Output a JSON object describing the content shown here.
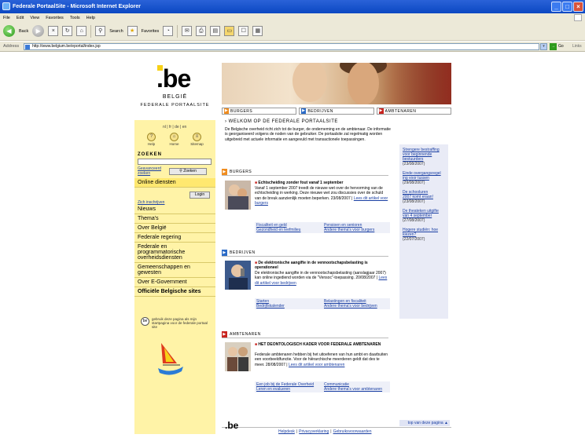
{
  "window": {
    "title": "Federale PortaalSite - Microsoft Internet Explorer",
    "btn_min": "_",
    "btn_max": "□",
    "btn_close": "×"
  },
  "menu": [
    "File",
    "Edit",
    "View",
    "Favorites",
    "Tools",
    "Help"
  ],
  "toolbar": {
    "back": "Back",
    "search": "Search",
    "favorites": "Favorites"
  },
  "address": {
    "label": "Address",
    "url": "http://www.belgium.be/eportal/index.jsp",
    "go": "Go",
    "links": "Links"
  },
  "sidebar": {
    "logo_text": ".be",
    "country": "BELGIË",
    "portal": "FEDERALE PORTAALSITE",
    "languages": "nl | fr | de | en",
    "icons": [
      {
        "label": "Help",
        "icon": "question-icon",
        "glyph": "?"
      },
      {
        "label": "Home",
        "icon": "home-icon",
        "glyph": "⌂"
      },
      {
        "label": "Sitemap",
        "icon": "sitemap-icon",
        "glyph": "≡"
      }
    ],
    "search_title": "ZOEKEN",
    "advanced_link": "Geavanceerd zoeken",
    "search_button": "Zoeken",
    "online_services": "Online diensten",
    "login_link": "Zich inschrijven",
    "login_button": "Login",
    "nav": [
      "Nieuws",
      "Thema's",
      "Over België",
      "Federale regering",
      "Federale en programmatorische overheidsdiensten",
      "Gemeenschappen en gewesten",
      "Over E-Government",
      "Officiële Belgische sites"
    ],
    "bookmark_text": "gebruik deze pagina als mijn startpagina voor de federale portaal site"
  },
  "tabs": [
    {
      "label": "BURGERS",
      "color": "#f08c1e"
    },
    {
      "label": "BEDRIJVEN",
      "color": "#2b6bc7"
    },
    {
      "label": "AMBTENAREN",
      "color": "#c8231e"
    }
  ],
  "welcome": {
    "title": "WELKOM OP DE FEDERALE PORTAALSITE",
    "text": "De Belgische overheid richt zich tot de burger, de onderneming en de ambtenaar. De informatie is georganiseerd volgens de noden van de gebruiker. De portaalsite zal regelmatig worden uitgebreid met actuele informatie en aangevuld met transactionele toepassingen."
  },
  "sections": [
    {
      "head": "BURGERS",
      "headline": "Echtscheiding zonder fout vanaf 1 september",
      "body": "Vanaf 1 september 2007 treedt de nieuwe wet over de hervorming van de echtscheiding in werking. Deze nieuwe wet zou discussies over de schuld van de breuk aanzienlijk moeten beperken.   23/08/2007 |",
      "more": "Lees dit artikel voor burgers",
      "links": [
        "Fiscaliteit en geld",
        "Pensioen en senioren",
        "Gezondheid en leefmilieu",
        "Andere thema's voor burgers"
      ]
    },
    {
      "head": "BEDRIJVEN",
      "headline": "De elektronische aangifte in de vennootschapsbelasting is operationeel",
      "body": "De elektronische aangifte in de vennootschapsbelasting (aanslagjaar 2007) kan online ingediend worden via de \"Vensoc\"-toepassing.   20/08/2007 |",
      "more": "Lees dit artikel voor bedrijven",
      "links": [
        "Starten",
        "Belastingen en fiscaliteit",
        "Bedrijfskalender",
        "Andere thema's voor bedrijven"
      ]
    },
    {
      "head": "AMBTENAREN",
      "headline": "HET DEONTOLOGISCH KADER VOOR FEDERALE AMBTENAREN",
      "body": "Federale ambtenaren hebben bij het uitoefenen van hun ambt en daarbuiten een voorbeeldfunctie. Voor de hiërarchische meerderen geldt dat des te meer.   28/08/2007 |",
      "more": "Lees dit artikel voor ambtenaren",
      "links": [
        "Een job bij de Federale Overheid",
        "Communicatie",
        "Leren en evalueren",
        "Andere thema's voor ambtenaren"
      ]
    }
  ],
  "right_news": [
    {
      "title": "Strengere bestraffing voor beginnende bestuurders",
      "date": "(23/08/2007)"
    },
    {
      "title": "Einde overgangsregel ing voor tussen",
      "date": "(29/08/2007)"
    },
    {
      "title": "De schooluren",
      "title2": "2007 komt eraan!",
      "date": "(23/08/2007)"
    },
    {
      "title": "De theateken uitgifte van 4 september",
      "date": "(27/08/2007)"
    },
    {
      "title": "Hogere studiën: hoe kiezen?",
      "date": "(22/07/2007)"
    }
  ],
  "top_link": "top van deze pagina",
  "footer": {
    "logo": ".be",
    "links": [
      "Helpdesk",
      "Privacyverklaring",
      "Gebruiksvoorwaarden"
    ]
  }
}
